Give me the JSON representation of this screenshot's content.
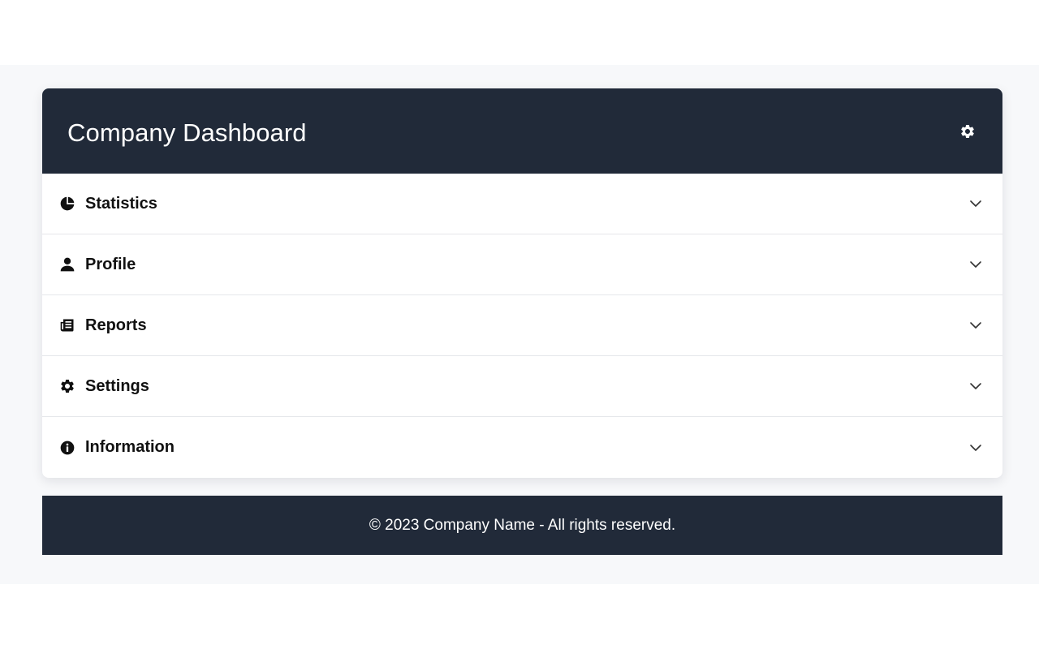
{
  "header": {
    "title": "Company Dashboard",
    "settings_icon": "gear-icon"
  },
  "accordion": {
    "items": [
      {
        "label": "Statistics",
        "icon": "pie-chart-icon"
      },
      {
        "label": "Profile",
        "icon": "user-icon"
      },
      {
        "label": "Reports",
        "icon": "newspaper-icon"
      },
      {
        "label": "Settings",
        "icon": "gear-icon"
      },
      {
        "label": "Information",
        "icon": "info-circle-icon"
      }
    ],
    "expand_icon": "chevron-down-icon"
  },
  "footer": {
    "text": "© 2023 Company Name - All rights reserved."
  },
  "colors": {
    "header_bg": "#212a39",
    "page_bg": "#f7f8fa",
    "card_bg": "#ffffff",
    "divider": "#e5e7eb",
    "text_dark": "#111111",
    "text_light": "#ffffff"
  }
}
